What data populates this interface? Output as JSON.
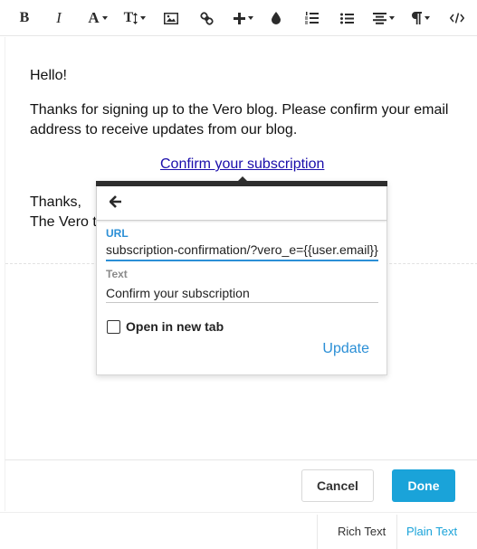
{
  "toolbar": {
    "bold": "B",
    "italic": "I",
    "font_color": "A",
    "font_size": "T"
  },
  "email": {
    "greeting": "Hello!",
    "body_line1": "Thanks for signing up to the Vero blog. Please confirm your email",
    "body_line2": "address to receive updates from our blog.",
    "link_text": "Confirm your subscription",
    "signoff": "Thanks,",
    "signature": "The Vero t"
  },
  "link_popover": {
    "url_label": "URL",
    "url_value": "subscription-confirmation/?vero_e={{user.email}}",
    "text_label": "Text",
    "text_value": "Confirm your subscription",
    "new_tab_label": "Open in new tab",
    "new_tab_checked": false,
    "update_label": "Update"
  },
  "actions": {
    "cancel_label": "Cancel",
    "done_label": "Done"
  },
  "mode_tabs": {
    "rich_text": "Rich Text",
    "plain_text": "Plain Text",
    "active": "Plain Text"
  },
  "colors": {
    "accent": "#1aa3d9",
    "link_blue": "#2b8fd6",
    "label_grey": "#8a8a8a"
  }
}
